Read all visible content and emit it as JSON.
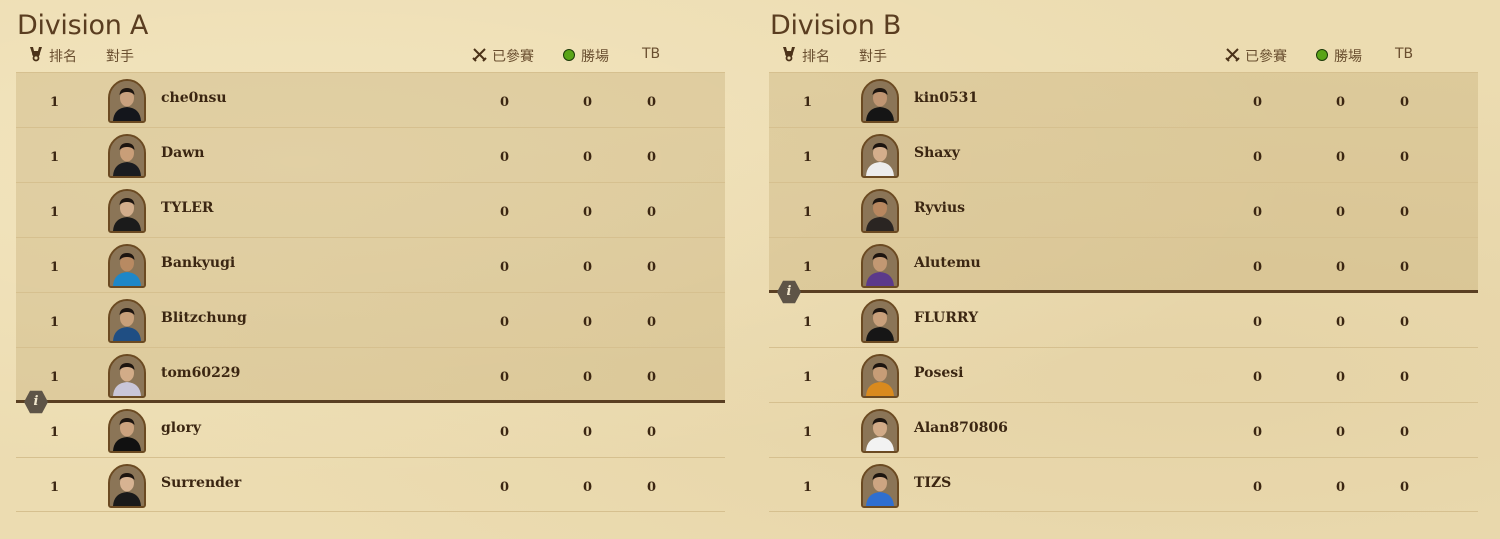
{
  "headers": {
    "rank": "排名",
    "opponent": "對手",
    "played": "已參賽",
    "wins": "勝場",
    "tb": "TB"
  },
  "colors": {
    "background": "#ecdcb1",
    "qualified_row": "#dcc79b",
    "text": "#3b2612",
    "cutline": "#5a3f22",
    "win_dot": "#5aa417"
  },
  "icons": {
    "rank": "trophy-icon",
    "played": "crossed-swords-icon",
    "wins": "green-dot-icon",
    "cutline": "info-icon"
  },
  "divisions": [
    {
      "title": "Division A",
      "players": [
        {
          "rank": "1",
          "name": "che0nsu",
          "played": "0",
          "wins": "0",
          "tb": "0",
          "qualified": true,
          "shirt": "#14161c",
          "skin": "#c9a17e"
        },
        {
          "rank": "1",
          "name": "Dawn",
          "played": "0",
          "wins": "0",
          "tb": "0",
          "qualified": true,
          "shirt": "#1a1c20",
          "skin": "#c99e78"
        },
        {
          "rank": "1",
          "name": "TYLER",
          "played": "0",
          "wins": "0",
          "tb": "0",
          "qualified": true,
          "shirt": "#1b1b1b",
          "skin": "#d2ad8b"
        },
        {
          "rank": "1",
          "name": "Bankyugi",
          "played": "0",
          "wins": "0",
          "tb": "0",
          "qualified": true,
          "shirt": "#1e87c8",
          "skin": "#b88a62"
        },
        {
          "rank": "1",
          "name": "Blitzchung",
          "played": "0",
          "wins": "0",
          "tb": "0",
          "qualified": true,
          "shirt": "#1f4e83",
          "skin": "#c8a07a"
        },
        {
          "rank": "1",
          "name": "tom60229",
          "played": "0",
          "wins": "0",
          "tb": "0",
          "qualified": true,
          "shirt": "#c9c6d8",
          "skin": "#d2ac88"
        },
        {
          "rank": "1",
          "name": "glory",
          "played": "0",
          "wins": "0",
          "tb": "0",
          "qualified": false,
          "shirt": "#111111",
          "skin": "#cba27e"
        },
        {
          "rank": "1",
          "name": "Surrender",
          "played": "0",
          "wins": "0",
          "tb": "0",
          "qualified": false,
          "shirt": "#1a1a1a",
          "skin": "#d7b392"
        }
      ]
    },
    {
      "title": "Division B",
      "players": [
        {
          "rank": "1",
          "name": "kin0531",
          "played": "0",
          "wins": "0",
          "tb": "0",
          "qualified": true,
          "shirt": "#151515",
          "skin": "#bf9572"
        },
        {
          "rank": "1",
          "name": "Shaxy",
          "played": "0",
          "wins": "0",
          "tb": "0",
          "qualified": true,
          "shirt": "#ececec",
          "skin": "#d4ae8c"
        },
        {
          "rank": "1",
          "name": "Ryvius",
          "played": "0",
          "wins": "0",
          "tb": "0",
          "qualified": true,
          "shirt": "#2a2522",
          "skin": "#b8875f"
        },
        {
          "rank": "1",
          "name": "Alutemu",
          "played": "0",
          "wins": "0",
          "tb": "0",
          "qualified": true,
          "shirt": "#5b3a8a",
          "skin": "#c29873"
        },
        {
          "rank": "1",
          "name": "FLURRY",
          "played": "0",
          "wins": "0",
          "tb": "0",
          "qualified": false,
          "shirt": "#161616",
          "skin": "#c9a07b"
        },
        {
          "rank": "1",
          "name": "Posesi",
          "played": "0",
          "wins": "0",
          "tb": "0",
          "qualified": false,
          "shirt": "#d98a1e",
          "skin": "#c79d77"
        },
        {
          "rank": "1",
          "name": "Alan870806",
          "played": "0",
          "wins": "0",
          "tb": "0",
          "qualified": false,
          "shirt": "#f2f2f2",
          "skin": "#d2ab88"
        },
        {
          "rank": "1",
          "name": "TIZS",
          "played": "0",
          "wins": "0",
          "tb": "0",
          "qualified": false,
          "shirt": "#2f6fd0",
          "skin": "#cda582"
        }
      ]
    }
  ]
}
